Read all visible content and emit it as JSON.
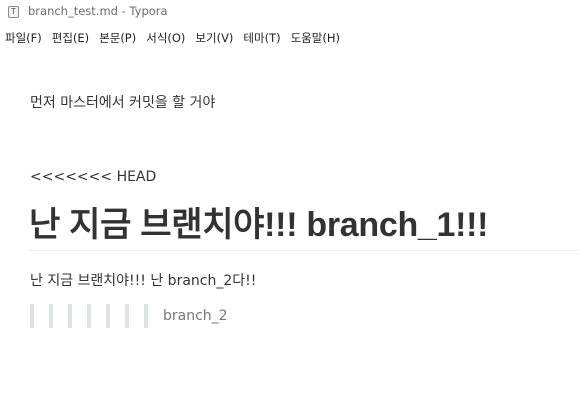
{
  "window": {
    "title": "branch_test.md - Typora",
    "app_icon_glyph": "T",
    "app_icon_name": "typora-icon"
  },
  "menu": [
    {
      "label": "파일(F)"
    },
    {
      "label": "편집(E)"
    },
    {
      "label": "본문(P)"
    },
    {
      "label": "서식(O)"
    },
    {
      "label": "보기(V)"
    },
    {
      "label": "테마(T)"
    },
    {
      "label": "도움말(H)"
    }
  ],
  "document": {
    "intro": "먼저 마스터에서 커밋을 할 거야",
    "conflict_start": "<<<<<<< HEAD",
    "heading": "난 지금 브랜치야!!! branch_1!!!",
    "branch2_line": "난 지금 브랜치야!!! 난 branch_2다!!",
    "quote_text": "branch_2",
    "quote_depth": 7
  },
  "colors": {
    "text": "#333333",
    "muted": "#777777",
    "quote_bar": "#dfe2e5",
    "title_text": "#6b6b6b"
  }
}
